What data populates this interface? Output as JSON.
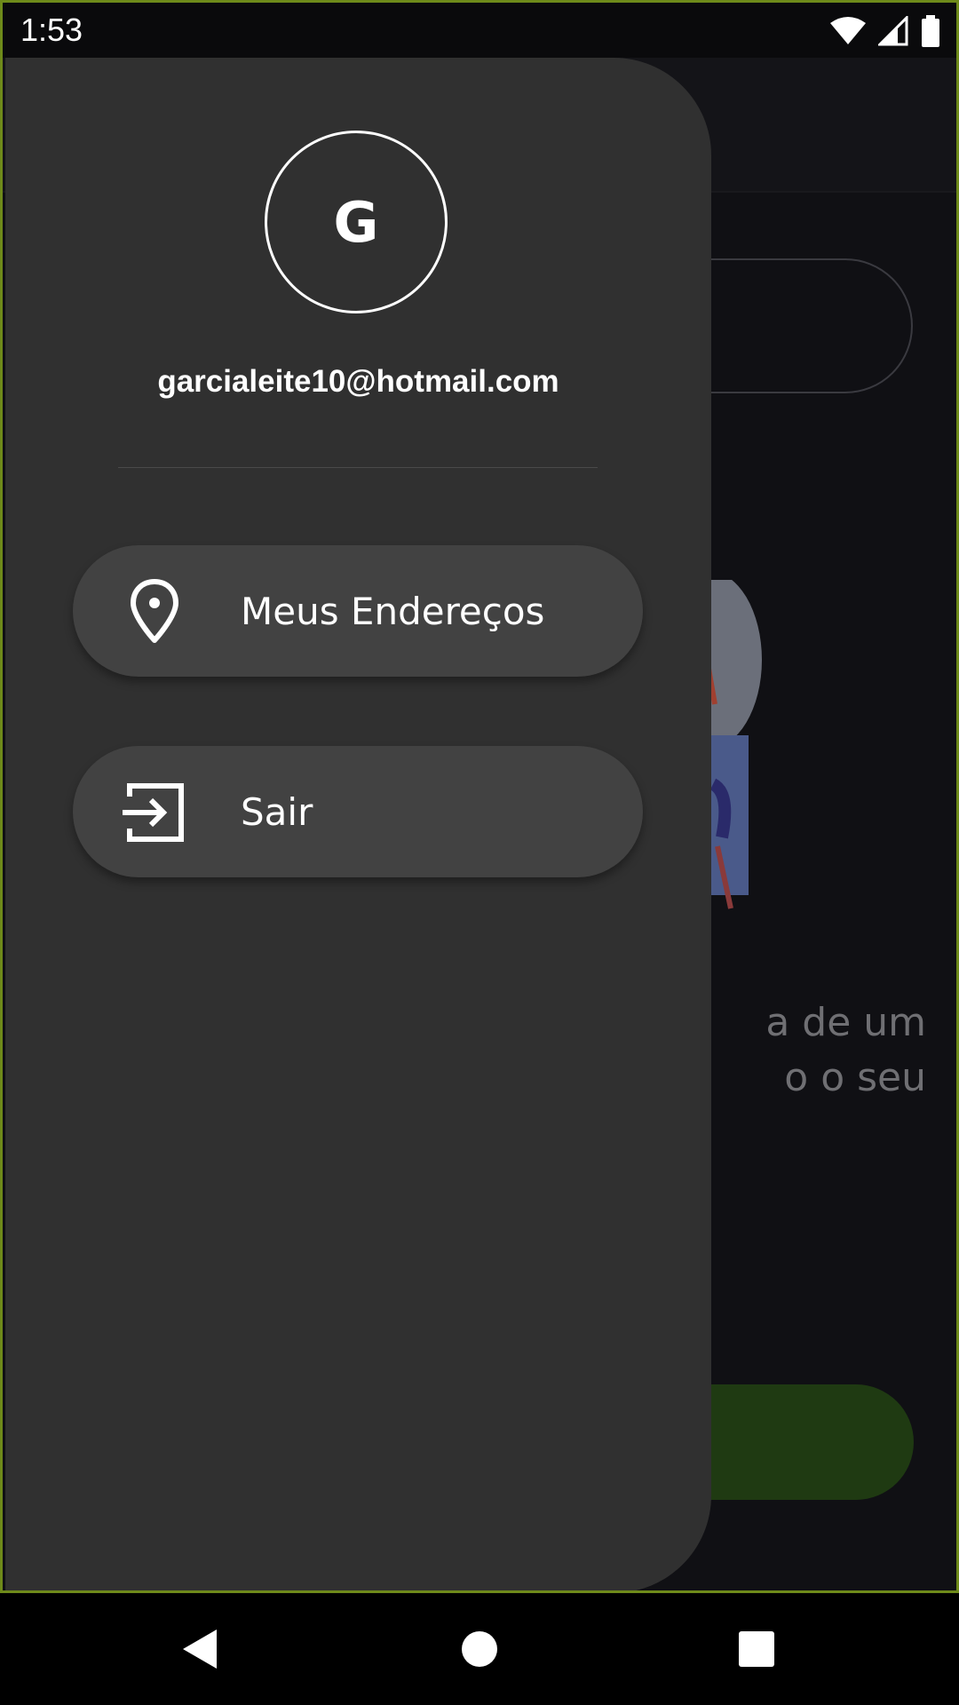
{
  "status_bar": {
    "time": "1:53",
    "icons": [
      "wifi-icon",
      "signal-icon",
      "battery-icon"
    ]
  },
  "background": {
    "text": "a de um\no o seu"
  },
  "drawer": {
    "avatar_initial": "G",
    "email": "garcialeite10@hotmail.com",
    "items": [
      {
        "label": "Meus Endereços",
        "icon": "location-pin-icon"
      },
      {
        "label": "Sair",
        "icon": "logout-icon"
      }
    ]
  },
  "navigation": {
    "buttons": [
      "back-icon",
      "home-icon",
      "recents-icon"
    ]
  },
  "colors": {
    "drawer_bg": "#303030",
    "menu_item_bg": "#424242",
    "accent_green": "#1f3a12",
    "frame_outline": "#6e8a1a"
  }
}
